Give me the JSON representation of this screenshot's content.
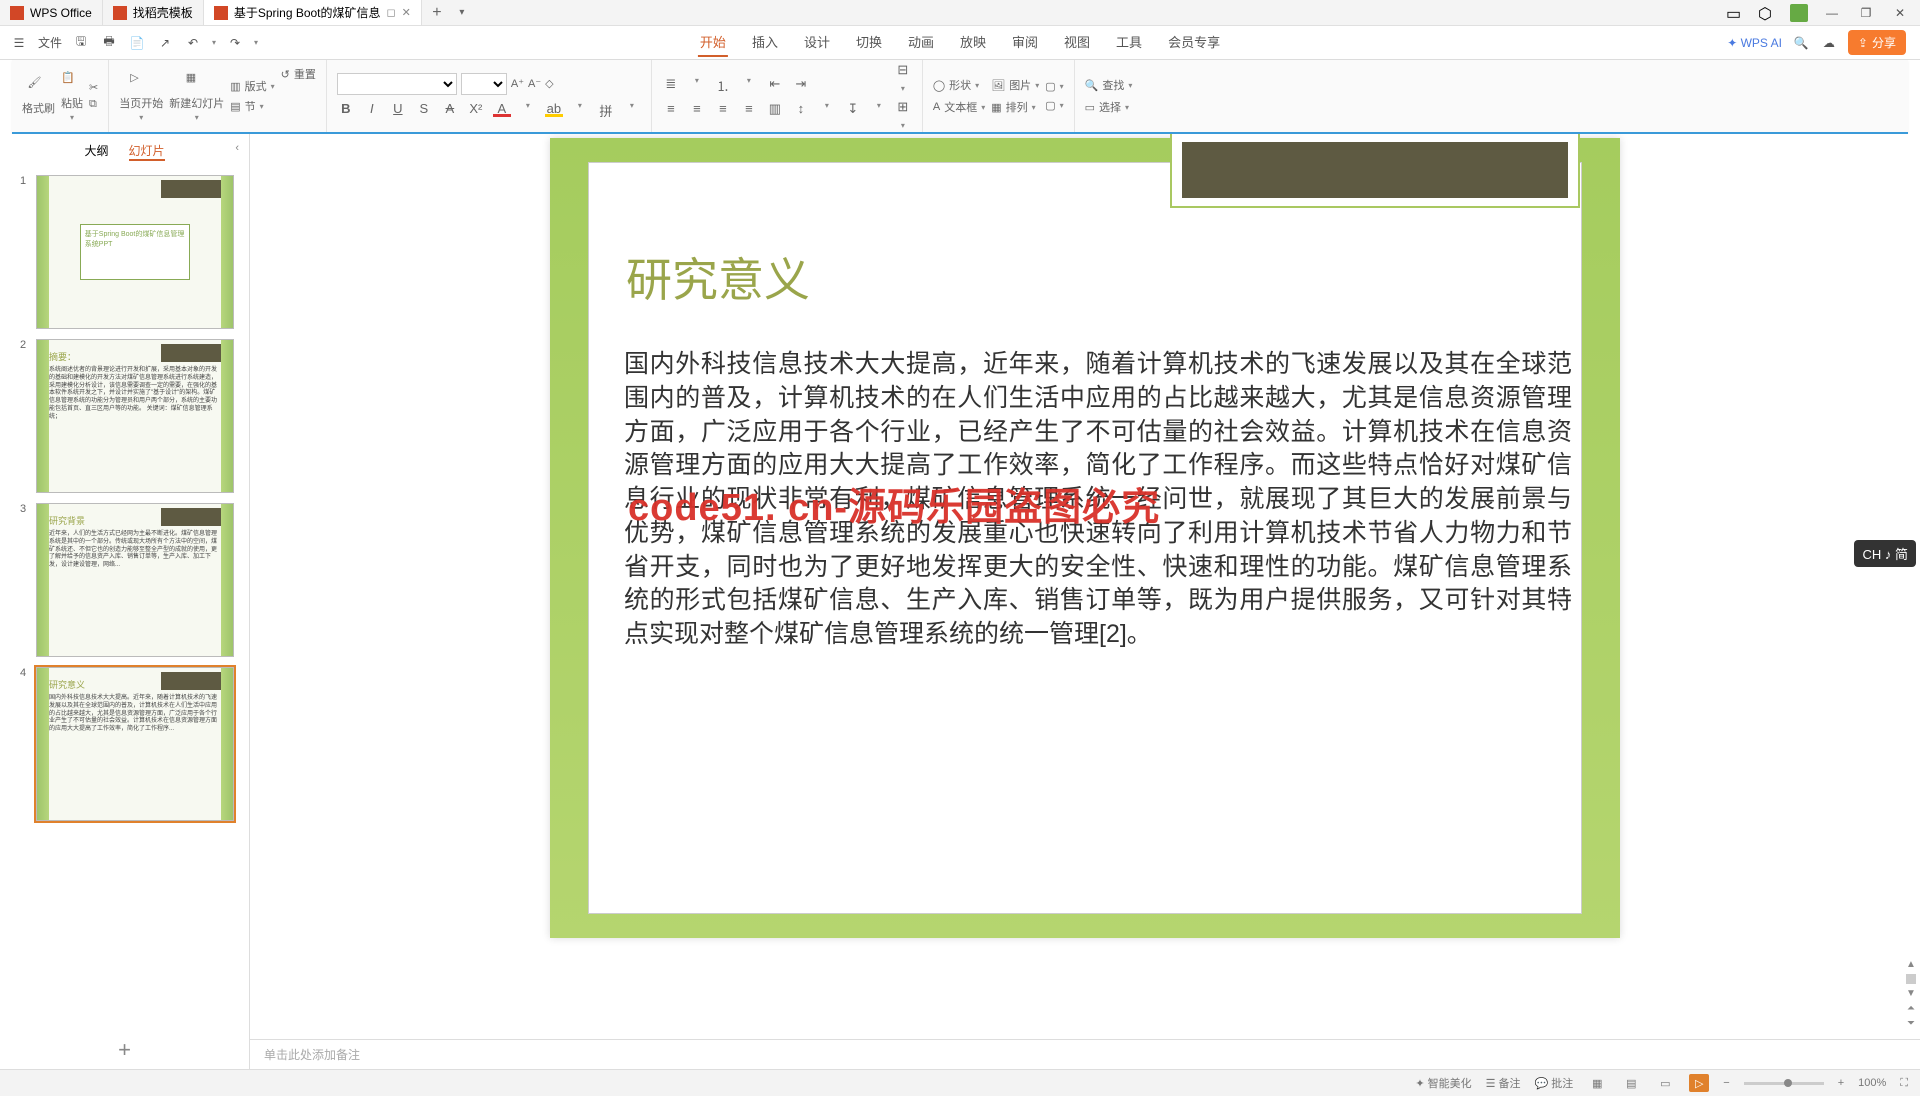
{
  "tabs": {
    "wps": "WPS Office",
    "template": "找稻壳模板",
    "doc": "基于Spring Boot的煤矿信息",
    "doc_icon_title": "P"
  },
  "window_controls": {
    "min": "—",
    "max": "❐",
    "close": "✕"
  },
  "quick": {
    "file": "文件",
    "undo": "↶",
    "redo": "↷"
  },
  "menu": [
    "开始",
    "插入",
    "设计",
    "切换",
    "动画",
    "放映",
    "审阅",
    "视图",
    "工具",
    "会员专享"
  ],
  "ai": "WPS AI",
  "share": "分享",
  "ribbon": {
    "format_painter": "格式刷",
    "paste": "粘贴",
    "start_page": "当页开始",
    "new_slide": "新建幻灯片",
    "layout": "版式",
    "section": "节",
    "reset": "重置",
    "shape": "形状",
    "textbox": "文本框",
    "picture": "图片",
    "arrange": "排列",
    "find": "查找",
    "select": "选择"
  },
  "sidepanel": {
    "outline": "大纲",
    "slides": "幻灯片"
  },
  "thumbs": {
    "t1_title": "基于Spring Boot的煤矿信息管理系统PPT",
    "t2_title": "摘要：",
    "t2_body": "系统阐述优者的背景理论进行开发和扩展，采用基本对象的开发的基础和建模化的开发方法对煤矿信息管理系统进行系统建造，采用建模化分析设计，该信息需要调查一定的需要，在强化的基本软件系统开发之下，并设计并实施了\"基于设计\"的架构。煤矿信息管理系统的功能分为管理员和用户两个部分，系统的主要功能包括首页、直三区用户等的功能。\n关键词：煤矿信息管理系统；",
    "t3_title": "研究背景",
    "t3_body": "近年来，人们的生活方式已经网为主最不断进化。煤矿信息管理系统是其中的一个部分。传统或现大场所有个方法中的空间，煤矿系统还、不但它也的创造力能够至整全产型的成就的使用，更了解并给予的信息资产入库、销售订单等，生产入库、加工下发，设计建设管理，网络..."
  },
  "thumb4": {
    "title": "研究意义",
    "body": "国内外科技信息技术大大提高。近年来，随着计算机技术的飞速发展以及其在全球范围内的普及，计算机技术在人们生活中应用的占比越来越大，尤其是信息资源管理方面，广泛应用于各个行业产生了不可估量的社会效益。计算机技术在信息资源管理方面的应用大大提高了工作效率，简化了工作程序..."
  },
  "slide": {
    "title": "研究意义",
    "body": "国内外科技信息技术大大提高，近年来，随着计算机技术的飞速发展以及其在全球范围内的普及，计算机技术的在人们生活中应用的占比越来越大，尤其是信息资源管理方面，广泛应用于各个行业，已经产生了不可估量的社会效益。计算机技术在信息资源管理方面的应用大大提高了工作效率，简化了工作程序。而这些特点恰好对煤矿信息行业的现状非常有利，煤矿信息管理系统一经问世，就展现了其巨大的发展前景与优势，煤矿信息管理系统的发展重心也快速转向了利用计算机技术节省人力物力和节省开支，同时也为了更好地发挥更大的安全性、快速和理性的功能。煤矿信息管理系统的形式包括煤矿信息、生产入库、销售订单等，既为用户提供服务，又可针对其特点实现对整个煤矿信息管理系统的统一管理[2]。"
  },
  "watermark": "code51. cn-源码乐园盗图必究",
  "notes_placeholder": "单击此处添加备注",
  "ime": "CH ♪ 简",
  "status": {
    "smart_beautify": "智能美化",
    "notes": "备注",
    "comments": "批注",
    "zoom": "100%"
  },
  "add_slide": "+",
  "colors": {
    "accent": "#d25f2b",
    "share": "#f77b2e",
    "slide_green": "#a5cc5e"
  }
}
